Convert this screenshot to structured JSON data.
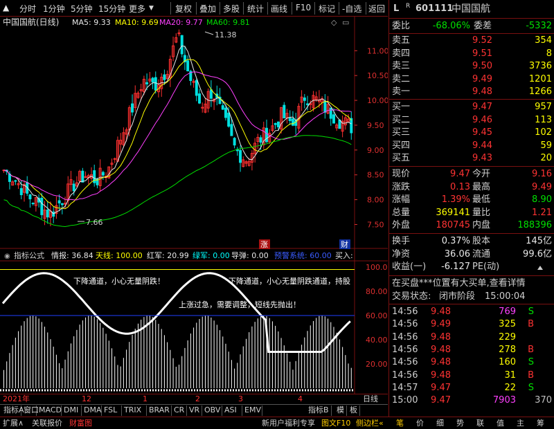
{
  "toolbar": {
    "left_items": [
      "分时",
      "1分钟",
      "5分钟",
      "15分钟",
      "更多"
    ],
    "right_items": [
      "复权",
      "叠加",
      "多股",
      "统计",
      "画线",
      "F10",
      "标记",
      "-自选",
      "返回"
    ]
  },
  "chart_header": {
    "name": "中国国航(日线)",
    "ma5": "MA5: 9.33",
    "ma10": "MA10: 9.69",
    "ma20": "MA20: 9.77",
    "ma60": "MA60: 9.81",
    "high_annot": "11.38",
    "low_annot": "7.66",
    "zhang": "涨",
    "cai": "财"
  },
  "indicator_header": {
    "title": "指标公式",
    "qingbao": "情报: 36.84",
    "tianxian": "天线: 100.00",
    "hongjun": "红军: 20.99",
    "lujun": "绿军: 0.00",
    "daodan": "导弹: 0.00",
    "yujing": "预警系统: 60.00",
    "mairu": "买入:"
  },
  "annotations": [
    "下降通道，小心无量阴跌！",
    "下降通道，小心无量阴跌通道，持股",
    "上涨过急，需要调整，短线先抛出！"
  ],
  "axis_labels": [
    "2021年",
    "12",
    "1",
    "2",
    "3",
    "4",
    "日线"
  ],
  "tabs": [
    "指标A",
    "窗口",
    "MACD",
    "DMI",
    "DMA",
    "FSL",
    "TRIX",
    "BRAR",
    "CR",
    "VR",
    "OBV",
    "ASI",
    "EMV"
  ],
  "tab_right": [
    "指标B",
    "模",
    "板"
  ],
  "bottom_left": [
    "扩展∧",
    "关联报价",
    "财富图"
  ],
  "bottom_right": [
    "新用户福利专享",
    "图文F10",
    "侧边栏«"
  ],
  "bottom_nav": [
    "笔",
    "价",
    "细",
    "势",
    "联",
    "值",
    "主",
    "筹"
  ],
  "stock": {
    "badge": "L",
    "code": "601111",
    "name": "中国国航",
    "r300": "R"
  },
  "weibi": {
    "label": "委比",
    "value": "-68.06%",
    "label2": "委差",
    "value2": "-5332"
  },
  "sell": [
    {
      "label": "卖五",
      "price": "9.52",
      "vol": "354"
    },
    {
      "label": "卖四",
      "price": "9.51",
      "vol": "8"
    },
    {
      "label": "卖三",
      "price": "9.50",
      "vol": "3736"
    },
    {
      "label": "卖二",
      "price": "9.49",
      "vol": "1201"
    },
    {
      "label": "卖一",
      "price": "9.48",
      "vol": "1266"
    }
  ],
  "buy": [
    {
      "label": "买一",
      "price": "9.47",
      "vol": "957"
    },
    {
      "label": "买二",
      "price": "9.46",
      "vol": "113"
    },
    {
      "label": "买三",
      "price": "9.45",
      "vol": "102"
    },
    {
      "label": "买四",
      "price": "9.44",
      "vol": "59"
    },
    {
      "label": "买五",
      "price": "9.43",
      "vol": "20"
    }
  ],
  "quote": [
    {
      "l1": "现价",
      "v1": "9.47",
      "l2": "今开",
      "v2": "9.16"
    },
    {
      "l1": "涨跌",
      "v1": "0.13",
      "l2": "最高",
      "v2": "9.49"
    },
    {
      "l1": "涨幅",
      "v1": "1.39%",
      "l2": "最低",
      "v2": "8.90"
    },
    {
      "l1": "总量",
      "v1": "369141",
      "l2": "量比",
      "v2": "1.21"
    },
    {
      "l1": "外盘",
      "v1": "180745",
      "l2": "内盘",
      "v2": "188396"
    }
  ],
  "stats": [
    {
      "l1": "换手",
      "v1": "0.37%",
      "l2": "股本",
      "v2": "145亿"
    },
    {
      "l1": "净资",
      "v1": "36.06",
      "l2": "流通",
      "v2": "99.6亿"
    },
    {
      "l1": "收益(一)",
      "v1": "-6.127",
      "l2": "PE(动)",
      "v2": ""
    }
  ],
  "notice": "在买盘***位置有大买单,查看详情",
  "trade_status": {
    "label": "交易状态:",
    "status": "闭市阶段",
    "time": "15:00:04"
  },
  "ticks": [
    {
      "time": "14:56",
      "price": "9.48",
      "vol": "769",
      "flag": "S"
    },
    {
      "time": "14:56",
      "price": "9.49",
      "vol": "325",
      "flag": "B"
    },
    {
      "time": "14:56",
      "price": "9.48",
      "vol": "229",
      "flag": ""
    },
    {
      "time": "14:56",
      "price": "9.48",
      "vol": "278",
      "flag": "B"
    },
    {
      "time": "14:56",
      "price": "9.48",
      "vol": "160",
      "flag": "S"
    },
    {
      "time": "14:56",
      "price": "9.48",
      "vol": "31",
      "flag": "B"
    },
    {
      "time": "14:57",
      "price": "9.47",
      "vol": "22",
      "flag": "S"
    },
    {
      "time": "15:00",
      "price": "9.47",
      "vol": "7903",
      "flag": "370"
    }
  ],
  "price_axis": [
    "11.00",
    "10.50",
    "10.00",
    "9.50",
    "9.00",
    "8.50",
    "8.00",
    "7.50"
  ],
  "ind_axis": [
    "100.0",
    "80.00",
    "60.00",
    "40.00",
    "20.00"
  ]
}
